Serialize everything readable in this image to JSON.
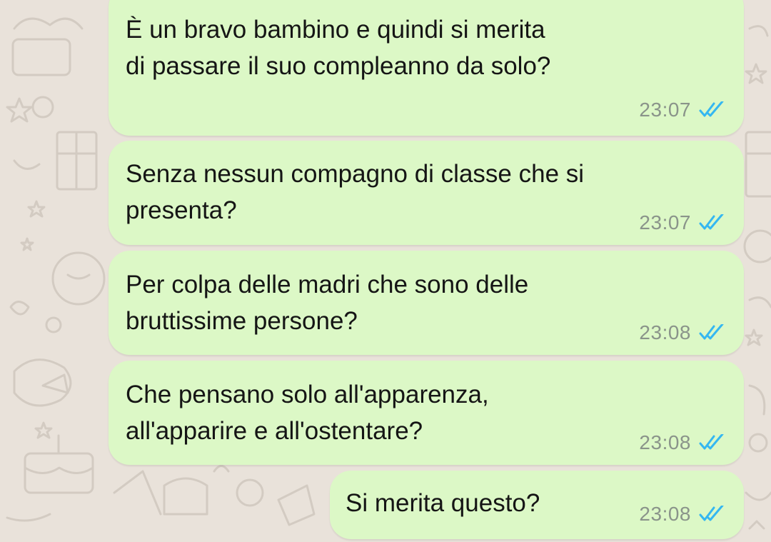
{
  "chat": {
    "colors": {
      "background": "#e9e2da",
      "outgoing_bubble": "#dcf8c6",
      "read_ticks": "#34b7f1",
      "timestamp": "#8a948a"
    },
    "messages": [
      {
        "text": "È un bravo bambino e quindi si merita\ndi passare il suo compleanno da solo?",
        "time": "23:07",
        "status": "read"
      },
      {
        "text": "Senza nessun compagno di classe che si\npresenta?",
        "time": "23:07",
        "status": "read"
      },
      {
        "text": "Per colpa delle madri che sono delle\nbruttissime persone?",
        "time": "23:08",
        "status": "read"
      },
      {
        "text": "Che pensano solo all'apparenza,\nall'apparire e all'ostentare?",
        "time": "23:08",
        "status": "read"
      },
      {
        "text": "Si merita questo?",
        "time": "23:08",
        "status": "read"
      }
    ]
  }
}
